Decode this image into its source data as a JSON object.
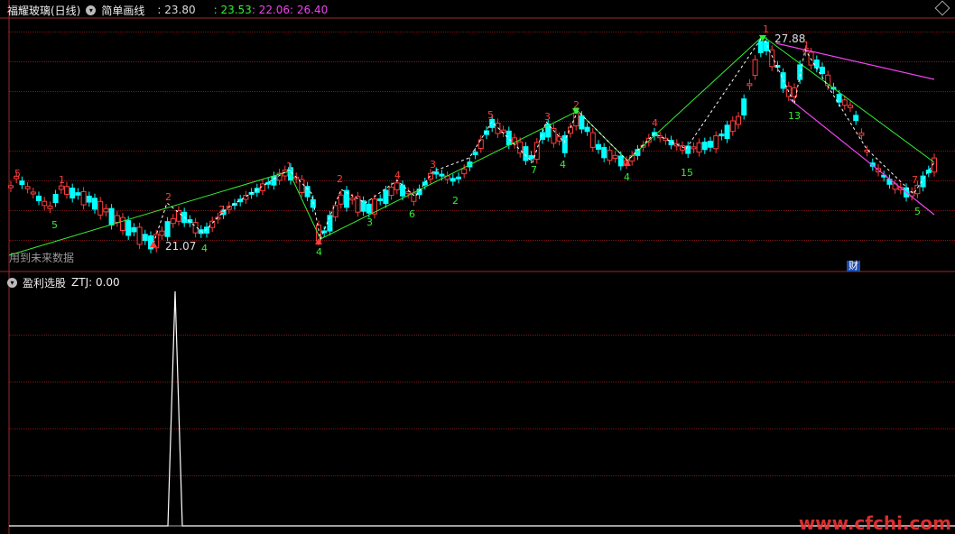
{
  "main_panel": {
    "title": "福耀玻璃(日线)",
    "indicator": "简单画线",
    "values": [
      {
        "text": ": 23.80",
        "color": "#dddddd"
      },
      {
        "text": ": 23.53",
        "color": "#33ee33"
      },
      {
        "text": ": 22.06",
        "color": "#ee44ee"
      },
      {
        "text": ": 26.40",
        "color": "#ee44ee"
      }
    ],
    "bottom_note": "用到未来数据",
    "fin_badge": "财",
    "high_label": "27.88",
    "low_label": "21.07"
  },
  "sub_panel": {
    "title": "盈利选股",
    "indicator_value": "ZTJ: 0.00"
  },
  "colors": {
    "up": "#ff3c3c",
    "down": "#00ffff",
    "zig": "#33ee33",
    "channel": "#ee44ee",
    "grid": "#7a1414"
  },
  "counts": {
    "red": [
      "5",
      "1",
      "2",
      "2",
      "1",
      "2",
      "4",
      "3",
      "5",
      "3",
      "2",
      "4",
      "1",
      "1",
      "7"
    ],
    "green": [
      "5",
      "5",
      "4",
      "4",
      "3",
      "6",
      "2",
      "7",
      "4",
      "4",
      "15",
      "13"
    ]
  },
  "watermark": "www.cfchi.com"
}
